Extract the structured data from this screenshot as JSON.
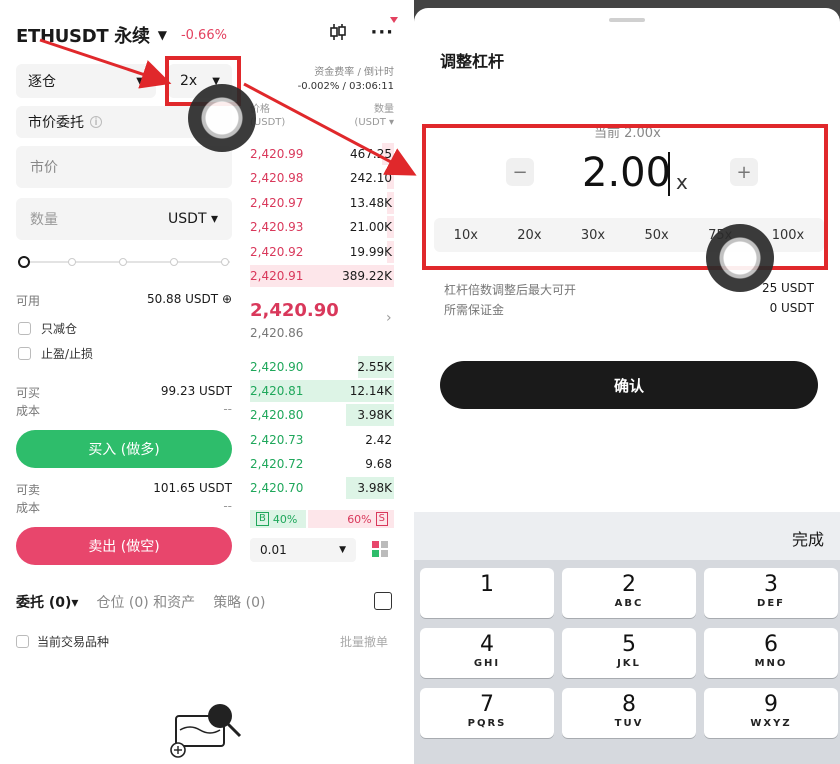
{
  "left": {
    "symbol": "ETHUSDT 永续",
    "change": "-0.66%",
    "margin_mode": "逐仓",
    "leverage": "2x",
    "order_type": "市价委托",
    "price_placeholder": "市价",
    "qty_placeholder": "数量",
    "qty_unit": "USDT",
    "available_label": "可用",
    "available_value": "50.88 USDT",
    "reduce_only": "只减仓",
    "tp_sl": "止盈/止损",
    "can_buy_label": "可买",
    "can_buy_value": "99.23 USDT",
    "cost_label": "成本",
    "cost_value": "--",
    "buy_button": "买入 (做多)",
    "can_sell_label": "可卖",
    "can_sell_value": "101.65 USDT",
    "cost2_label": "成本",
    "cost2_value": "--",
    "sell_button": "卖出 (做空)",
    "funding_label": "资金费率 / 倒计时",
    "funding_value": "-0.002% / 03:06:11",
    "ob_price_header": "价格",
    "ob_price_header_unit": "(USDT)",
    "ob_qty_header": "数量",
    "ob_qty_header_unit": "(USDT ▾",
    "asks": [
      {
        "price": "2,420.99",
        "qty": "467.25",
        "fill": 0.08
      },
      {
        "price": "2,420.98",
        "qty": "242.10",
        "fill": 0.05
      },
      {
        "price": "2,420.97",
        "qty": "13.48K",
        "fill": 0.05
      },
      {
        "price": "2,420.93",
        "qty": "21.00K",
        "fill": 0.05
      },
      {
        "price": "2,420.92",
        "qty": "19.99K",
        "fill": 0.05
      },
      {
        "price": "2,420.91",
        "qty": "389.22K",
        "fill": 1.0
      }
    ],
    "mid_price": "2,420.90",
    "mid_sub": "2,420.86",
    "bids": [
      {
        "price": "2,420.90",
        "qty": "2.55K",
        "fill": 0.25
      },
      {
        "price": "2,420.81",
        "qty": "12.14K",
        "fill": 1.0
      },
      {
        "price": "2,420.80",
        "qty": "3.98K",
        "fill": 0.33
      },
      {
        "price": "2,420.73",
        "qty": "2.42",
        "fill": 0.0
      },
      {
        "price": "2,420.72",
        "qty": "9.68",
        "fill": 0.0
      },
      {
        "price": "2,420.70",
        "qty": "3.98K",
        "fill": 0.33
      }
    ],
    "buy_ratio_tag": "B",
    "buy_ratio": "40%",
    "sell_ratio": "60%",
    "sell_ratio_tag": "S",
    "price_step": "0.01",
    "tabs": [
      "委托 (0)▾",
      "仓位 (0) 和资产",
      "策略 (0)"
    ],
    "current_symbol_only": "当前交易品种",
    "batch_cancel": "批量撤单"
  },
  "right": {
    "title": "调整杠杆",
    "current_label": "当前 2.00x",
    "leverage_value": "2.00",
    "leverage_unit": "x",
    "minus": "−",
    "plus": "+",
    "presets": [
      "10x",
      "20x",
      "30x",
      "50x",
      "75x",
      "100x"
    ],
    "max_open_label": "杠杆倍数调整后最大可开",
    "max_open_value": "25 USDT",
    "margin_req_label": "所需保证金",
    "margin_req_value": "0 USDT",
    "confirm": "确认",
    "keyboard_done": "完成",
    "keys": [
      {
        "n": "1",
        "s": ""
      },
      {
        "n": "2",
        "s": "ABC"
      },
      {
        "n": "3",
        "s": "DEF"
      },
      {
        "n": "4",
        "s": "GHI"
      },
      {
        "n": "5",
        "s": "JKL"
      },
      {
        "n": "6",
        "s": "MNO"
      },
      {
        "n": "7",
        "s": "PQRS"
      },
      {
        "n": "8",
        "s": "TUV"
      },
      {
        "n": "9",
        "s": "WXYZ"
      }
    ]
  },
  "colors": {
    "buy": "#2ebd6b",
    "sell": "#e8466c",
    "annotation": "#e0282b"
  },
  "icons": [
    "candlestick-icon",
    "more-icon",
    "info-icon",
    "chevron-right-icon",
    "order-history-icon",
    "empty-orders-icon"
  ]
}
